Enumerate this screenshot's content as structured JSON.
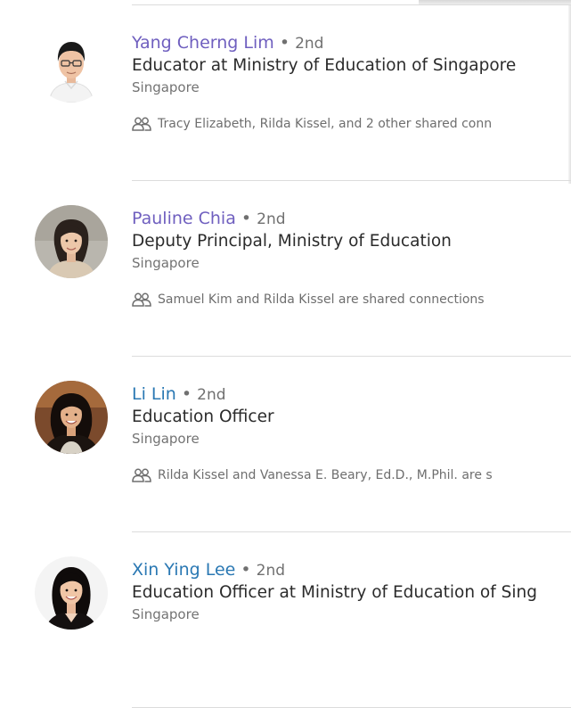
{
  "colors": {
    "visited_name": "#6f5fbf",
    "unvisited_name": "#2a78b3",
    "secondary_text": "#707070",
    "divider": "#dcdcdc"
  },
  "results": [
    {
      "name": "Yang Cherng Lim",
      "separator": "•",
      "degree": "2nd",
      "headline": "Educator at Ministry of Education of Singapore",
      "location": "Singapore",
      "shared_connections": "Tracy Elizabeth, Rilda Kissel, and 2 other shared conn",
      "icon": "shared-connections-icon"
    },
    {
      "name": "Pauline Chia",
      "separator": "•",
      "degree": "2nd",
      "headline": "Deputy Principal, Ministry of Education",
      "location": "Singapore",
      "shared_connections": "Samuel Kim and Rilda Kissel are shared connections",
      "icon": "shared-connections-icon"
    },
    {
      "name": "Li Lin",
      "separator": "•",
      "degree": "2nd",
      "headline": "Education Officer",
      "location": "Singapore",
      "shared_connections": "Rilda Kissel and Vanessa E. Beary, Ed.D., M.Phil. are s",
      "icon": "shared-connections-icon"
    },
    {
      "name": "Xin Ying Lee",
      "separator": "•",
      "degree": "2nd",
      "headline": "Education Officer at Ministry of Education of Sing",
      "location": "Singapore",
      "icon": "shared-connections-icon"
    }
  ]
}
